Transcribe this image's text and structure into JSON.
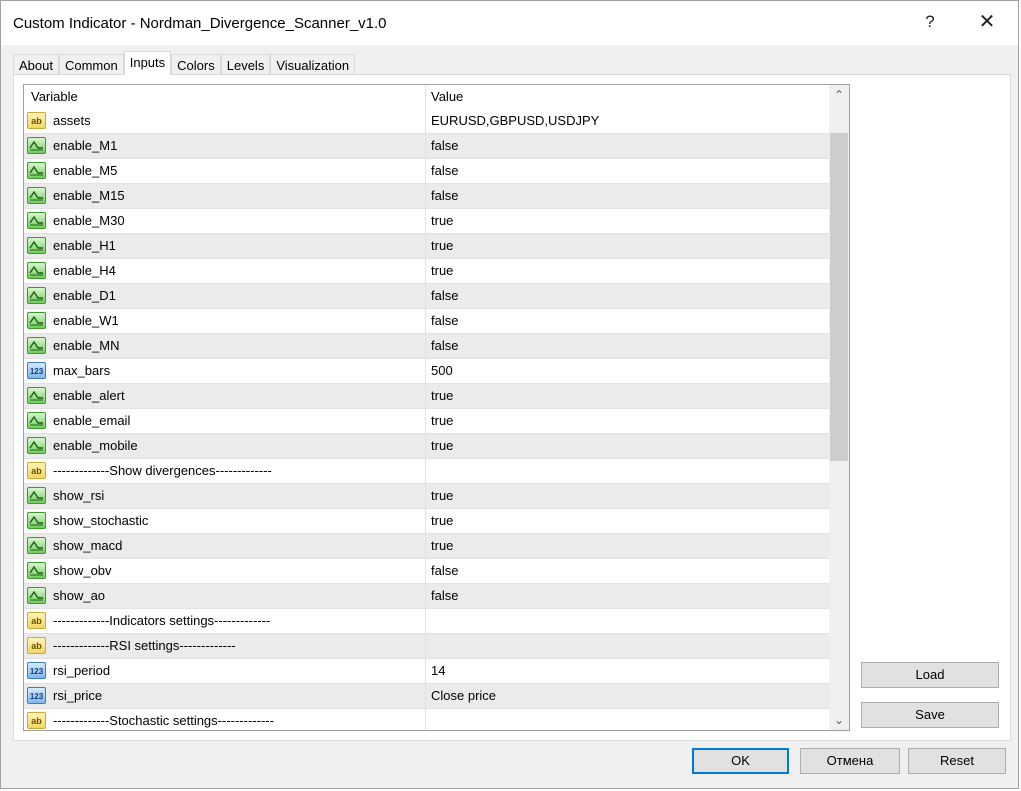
{
  "window": {
    "title": "Custom Indicator - Nordman_Divergence_Scanner_v1.0",
    "help_glyph": "?",
    "close_glyph": "✕"
  },
  "tabs": [
    {
      "label": "About"
    },
    {
      "label": "Common"
    },
    {
      "label": "Inputs",
      "active": true
    },
    {
      "label": "Colors"
    },
    {
      "label": "Levels"
    },
    {
      "label": "Visualization"
    }
  ],
  "grid": {
    "col_variable": "Variable",
    "col_value": "Value",
    "rows": [
      {
        "type": "str",
        "name": "assets",
        "value": "EURUSD,GBPUSD,USDJPY"
      },
      {
        "type": "bool",
        "name": "enable_M1",
        "value": "false"
      },
      {
        "type": "bool",
        "name": "enable_M5",
        "value": "false"
      },
      {
        "type": "bool",
        "name": "enable_M15",
        "value": "false"
      },
      {
        "type": "bool",
        "name": "enable_M30",
        "value": "true"
      },
      {
        "type": "bool",
        "name": "enable_H1",
        "value": "true"
      },
      {
        "type": "bool",
        "name": "enable_H4",
        "value": "true"
      },
      {
        "type": "bool",
        "name": "enable_D1",
        "value": "false"
      },
      {
        "type": "bool",
        "name": "enable_W1",
        "value": "false"
      },
      {
        "type": "bool",
        "name": "enable_MN",
        "value": "false"
      },
      {
        "type": "num",
        "name": "max_bars",
        "value": "500"
      },
      {
        "type": "bool",
        "name": "enable_alert",
        "value": "true"
      },
      {
        "type": "bool",
        "name": "enable_email",
        "value": "true"
      },
      {
        "type": "bool",
        "name": "enable_mobile",
        "value": "true"
      },
      {
        "type": "str",
        "name": "-------------Show divergences-------------",
        "value": ""
      },
      {
        "type": "bool",
        "name": "show_rsi",
        "value": "true"
      },
      {
        "type": "bool",
        "name": "show_stochastic",
        "value": "true"
      },
      {
        "type": "bool",
        "name": "show_macd",
        "value": "true"
      },
      {
        "type": "bool",
        "name": "show_obv",
        "value": "false"
      },
      {
        "type": "bool",
        "name": "show_ao",
        "value": "false"
      },
      {
        "type": "str",
        "name": "-------------Indicators settings-------------",
        "value": ""
      },
      {
        "type": "str",
        "name": "-------------RSI settings-------------",
        "value": ""
      },
      {
        "type": "num",
        "name": "rsi_period",
        "value": "14"
      },
      {
        "type": "num",
        "name": "rsi_price",
        "value": "Close price"
      },
      {
        "type": "str",
        "name": "-------------Stochastic settings-------------",
        "value": ""
      }
    ],
    "icon_labels": {
      "str": "ab",
      "num": "123"
    }
  },
  "side_buttons": {
    "load": "Load",
    "save": "Save"
  },
  "footer_buttons": {
    "ok": "OK",
    "cancel": "Отмена",
    "reset": "Reset"
  },
  "scrollbar": {
    "up_glyph": "⌃",
    "down_glyph": "⌄"
  }
}
